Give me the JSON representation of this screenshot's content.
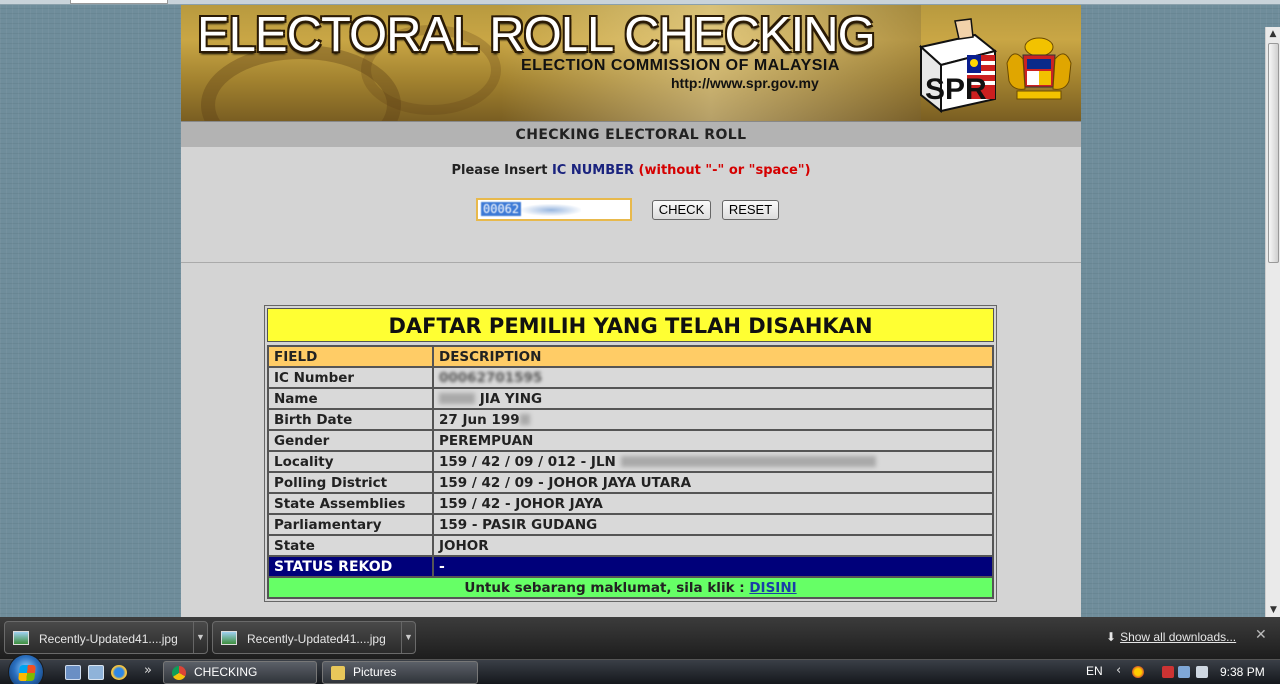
{
  "banner": {
    "title": "ELECTORAL ROLL CHECKING",
    "subtitle": "ELECTION COMMISSION OF MALAYSIA",
    "url": "http://www.spr.gov.my",
    "logo_text": "SPR"
  },
  "form": {
    "heading": "CHECKING ELECTORAL ROLL",
    "instruction_prefix": "Please Insert ",
    "instruction_ic": "IC NUMBER",
    "instruction_warning": "(without \"-\" or \"space\")",
    "ic_value": "00062",
    "check_label": "CHECK",
    "reset_label": "RESET"
  },
  "result": {
    "title": "DAFTAR PEMILIH YANG TELAH DISAHKAN",
    "header": {
      "field": "FIELD",
      "description": "DESCRIPTION"
    },
    "rows": [
      {
        "field": "IC Number",
        "value": "00062701595"
      },
      {
        "field": "Name",
        "value": "JIA YING"
      },
      {
        "field": "Birth Date",
        "value": "27 Jun 199"
      },
      {
        "field": "Gender",
        "value": "PEREMPUAN"
      },
      {
        "field": "Locality",
        "value": "159 / 42 / 09 / 012 - JLN"
      },
      {
        "field": "Polling District",
        "value": "159 / 42 / 09 - JOHOR JAYA UTARA"
      },
      {
        "field": "State Assemblies",
        "value": "159 / 42 - JOHOR JAYA"
      },
      {
        "field": "Parliamentary",
        "value": "159 - PASIR GUDANG"
      },
      {
        "field": "State",
        "value": "JOHOR"
      }
    ],
    "status": {
      "field": "STATUS REKOD",
      "value": "-"
    },
    "footer_text": "Untuk sebarang maklumat, sila klik : ",
    "footer_link": "DISINI"
  },
  "downloads": {
    "items": [
      {
        "name": "Recently-Updated41....jpg"
      },
      {
        "name": "Recently-Updated41....jpg"
      }
    ],
    "show_all": "Show all downloads..."
  },
  "taskbar": {
    "buttons": [
      {
        "label": "CHECKING ELECTO..."
      },
      {
        "label": "Pictures"
      }
    ],
    "language": "EN",
    "time": "9:38 PM"
  }
}
